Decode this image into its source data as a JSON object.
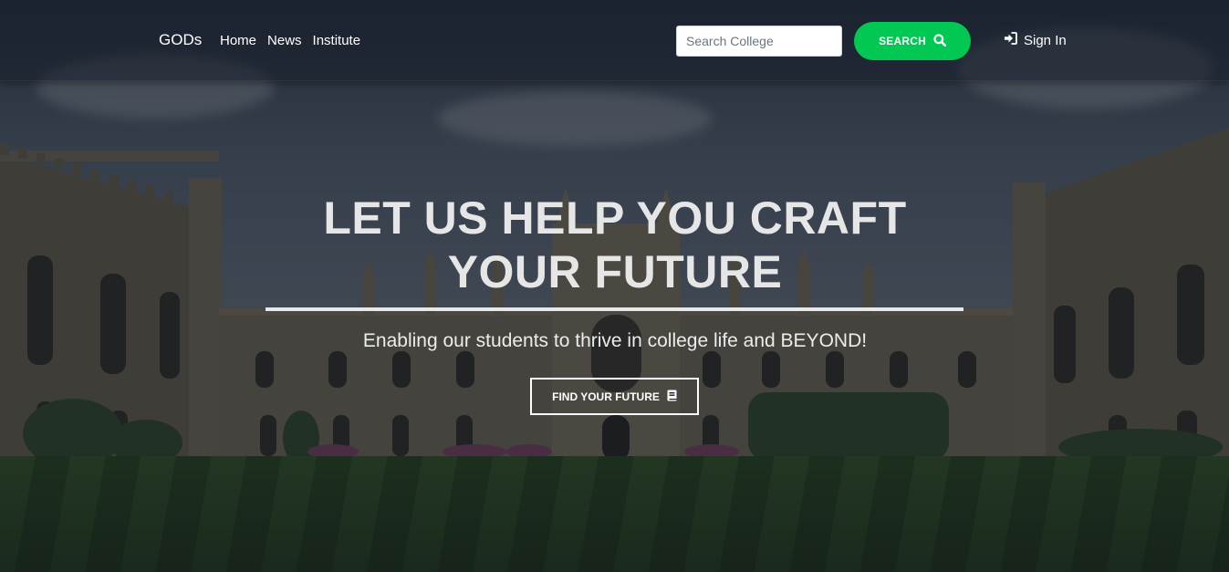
{
  "navbar": {
    "brand": "GODs",
    "links": [
      "Home",
      "News",
      "Institute"
    ],
    "search": {
      "placeholder": "Search College",
      "value": ""
    },
    "search_button": {
      "label": "SEARCH",
      "icon": "search-icon"
    },
    "signin": {
      "label": "Sign In",
      "icon": "sign-in-icon"
    }
  },
  "hero": {
    "title": "LET US HELP YOU CRAFT YOUR FUTURE",
    "subtitle": "Enabling our students to thrive in college life and BEYOND!",
    "cta": {
      "label": "FIND YOUR FUTURE",
      "icon": "book-icon"
    },
    "background": "college-quadrangle-photo"
  },
  "colors": {
    "accent": "#00c853",
    "text": "#ffffff",
    "overlay": "#121822"
  }
}
